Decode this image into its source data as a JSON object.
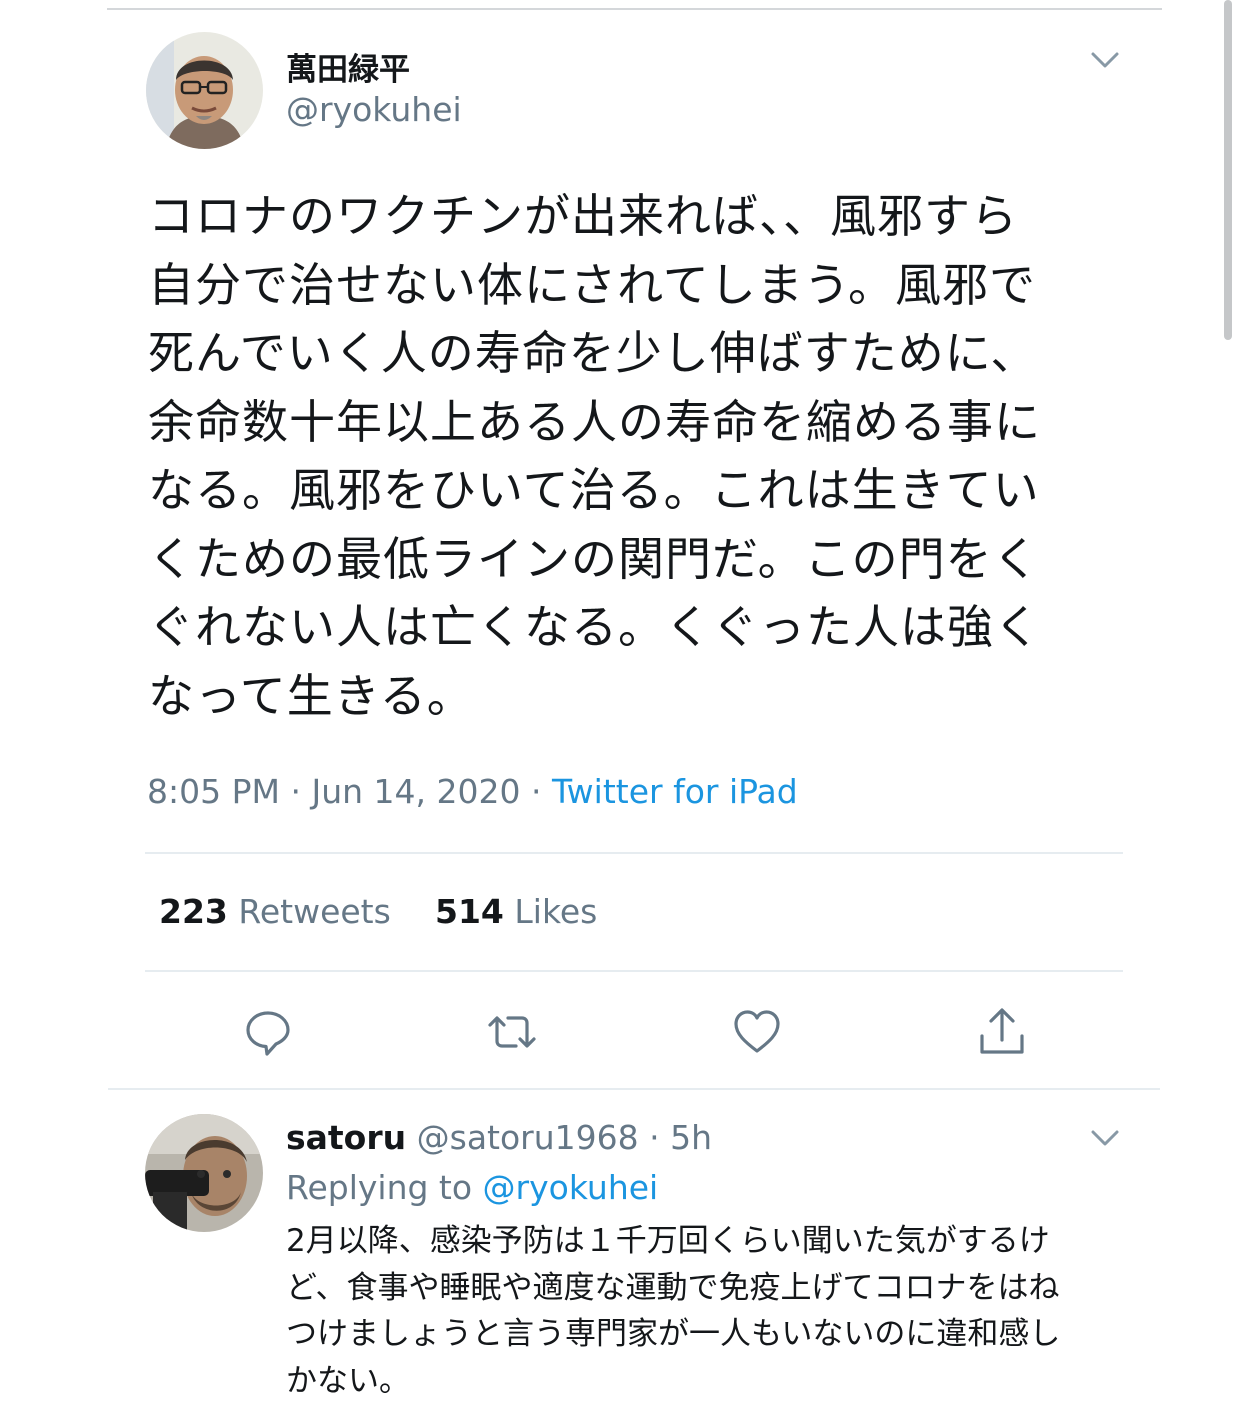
{
  "tweet": {
    "author_name": "萬田緑平",
    "author_handle": "@ryokuhei",
    "text_lines": [
      "コロナのワクチンが出来れば、、風邪すら",
      "自分で治せない体にされてしまう。風邪で",
      "死んでいく人の寿命を少し伸ばすために、",
      "余命数十年以上ある人の寿命を縮める事に",
      "なる。風邪をひいて治る。これは生きてい",
      "くための最低ラインの関門だ。この門をく",
      "ぐれない人は亡くなる。くぐった人は強く",
      "なって生きる。"
    ],
    "time": "8:05 PM",
    "date": "Jun 14, 2020",
    "separator": "·",
    "source": "Twitter for iPad",
    "retweets_count": "223",
    "retweets_label": "Retweets",
    "likes_count": "514",
    "likes_label": "Likes"
  },
  "actions": {
    "reply_icon": "reply-icon",
    "retweet_icon": "retweet-icon",
    "like_icon": "heart-icon",
    "share_icon": "share-icon",
    "icon_color": "#657786"
  },
  "reply": {
    "author_name": "satoru",
    "author_handle": "@satoru1968",
    "separator": "·",
    "time_ago": "5h",
    "replying_prefix": "Replying to",
    "replying_handle": "@ryokuhei",
    "text_lines": [
      "2月以降、感染予防は１千万回くらい聞いた気がするけ",
      "ど、食事や睡眠や適度な運動で免疫上げてコロナをはね",
      "つけましょうと言う専門家が一人もいないのに違和感し",
      "かない。"
    ]
  },
  "colors": {
    "primary_text": "#14171a",
    "secondary_text": "#657786",
    "link": "#1b95e0",
    "divider": "#e6ecf0"
  }
}
